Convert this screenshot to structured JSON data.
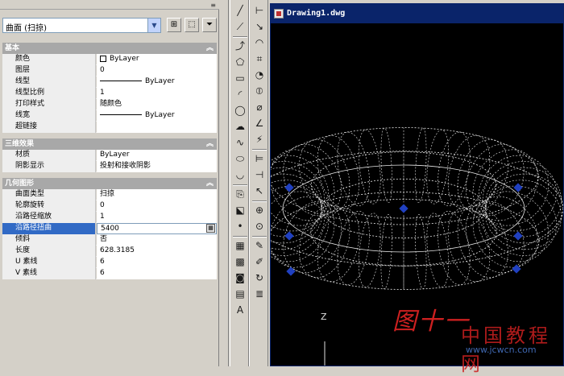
{
  "palette": {
    "object_selector": {
      "value": "曲面 (扫掠)",
      "dropdown_icon": "chevron-down-icon"
    },
    "buttons": [
      {
        "name": "toggle-pickadd-button",
        "icon": "pickadd-icon",
        "glyph": "⊞"
      },
      {
        "name": "select-objects-button",
        "icon": "select-cursor-icon",
        "glyph": "⬚"
      },
      {
        "name": "quick-select-button",
        "icon": "funnel-icon",
        "glyph": "⏷"
      }
    ],
    "sections": [
      {
        "title": "基本",
        "rows": [
          {
            "label": "颜色",
            "value": "ByLayer",
            "kind": "color"
          },
          {
            "label": "图层",
            "value": "0"
          },
          {
            "label": "线型",
            "value": "ByLayer",
            "kind": "line"
          },
          {
            "label": "线型比例",
            "value": "1"
          },
          {
            "label": "打印样式",
            "value": "随颜色"
          },
          {
            "label": "线宽",
            "value": "ByLayer",
            "kind": "line"
          },
          {
            "label": "超链接",
            "value": ""
          }
        ]
      },
      {
        "title": "三维效果",
        "rows": [
          {
            "label": "材质",
            "value": "ByLayer"
          },
          {
            "label": "阴影显示",
            "value": "投射和接收阴影"
          }
        ]
      },
      {
        "title": "几何图形",
        "rows": [
          {
            "label": "曲面类型",
            "value": "扫掠"
          },
          {
            "label": "轮廓旋转",
            "value": "0"
          },
          {
            "label": "沿路径缩放",
            "value": "1"
          },
          {
            "label": "沿路径扭曲",
            "value": "5400",
            "selected": true
          },
          {
            "label": "倾斜",
            "value": "否"
          },
          {
            "label": "长度",
            "value": "628.3185"
          },
          {
            "label": "U 素线",
            "value": "6"
          },
          {
            "label": "V 素线",
            "value": "6"
          }
        ]
      }
    ]
  },
  "draw_toolbar": [
    {
      "name": "line-icon",
      "glyph": "╱"
    },
    {
      "name": "construction-line-icon",
      "glyph": "⟋"
    },
    {
      "name": "polyline-icon",
      "glyph": "⤴"
    },
    {
      "name": "polygon-icon",
      "glyph": "⬠"
    },
    {
      "name": "rectangle-icon",
      "glyph": "▭"
    },
    {
      "name": "arc-icon",
      "glyph": "◜"
    },
    {
      "name": "circle-icon",
      "glyph": "◯"
    },
    {
      "name": "revision-cloud-icon",
      "glyph": "☁"
    },
    {
      "name": "spline-icon",
      "glyph": "∿"
    },
    {
      "name": "ellipse-icon",
      "glyph": "⬭"
    },
    {
      "name": "ellipse-arc-icon",
      "glyph": "◡"
    },
    {
      "name": "insert-block-icon",
      "glyph": "⎘"
    },
    {
      "name": "make-block-icon",
      "glyph": "⬕"
    },
    {
      "name": "point-icon",
      "glyph": "•"
    },
    {
      "name": "hatch-icon",
      "glyph": "▦"
    },
    {
      "name": "gradient-icon",
      "glyph": "▩"
    },
    {
      "name": "region-icon",
      "glyph": "◙"
    },
    {
      "name": "table-icon",
      "glyph": "▤"
    },
    {
      "name": "multiline-text-icon",
      "glyph": "A"
    }
  ],
  "dim_toolbar": [
    {
      "name": "linear-dimension-icon",
      "glyph": "⊢"
    },
    {
      "name": "aligned-dimension-icon",
      "glyph": "↘"
    },
    {
      "name": "arc-length-icon",
      "glyph": "◠"
    },
    {
      "name": "ordinate-dimension-icon",
      "glyph": "⌗"
    },
    {
      "name": "radius-dimension-icon",
      "glyph": "◔"
    },
    {
      "name": "jogged-dimension-icon",
      "glyph": "⦶"
    },
    {
      "name": "diameter-dimension-icon",
      "glyph": "⌀"
    },
    {
      "name": "angular-dimension-icon",
      "glyph": "∠"
    },
    {
      "name": "quick-dimension-icon",
      "glyph": "⚡"
    },
    {
      "name": "baseline-dimension-icon",
      "glyph": "⊨"
    },
    {
      "name": "continue-dimension-icon",
      "glyph": "⊣"
    },
    {
      "name": "quick-leader-icon",
      "glyph": "↖"
    },
    {
      "name": "tolerance-icon",
      "glyph": "⊕"
    },
    {
      "name": "center-mark-icon",
      "glyph": "⊙"
    },
    {
      "name": "dimension-edit-icon",
      "glyph": "✎"
    },
    {
      "name": "dimension-text-edit-icon",
      "glyph": "✐"
    },
    {
      "name": "dimension-update-icon",
      "glyph": "↻"
    },
    {
      "name": "dimension-style-icon",
      "glyph": "≣"
    }
  ],
  "drawing": {
    "title": "Drawing1.dwg",
    "background": "#000000",
    "wire_color": "#e8e8e8",
    "grip_color": "#2040c0",
    "axis_label": "Z"
  },
  "overlay": {
    "caption": "图十一",
    "watermark": "中国教程网",
    "watermark_url": "www.jcwcn.com"
  }
}
